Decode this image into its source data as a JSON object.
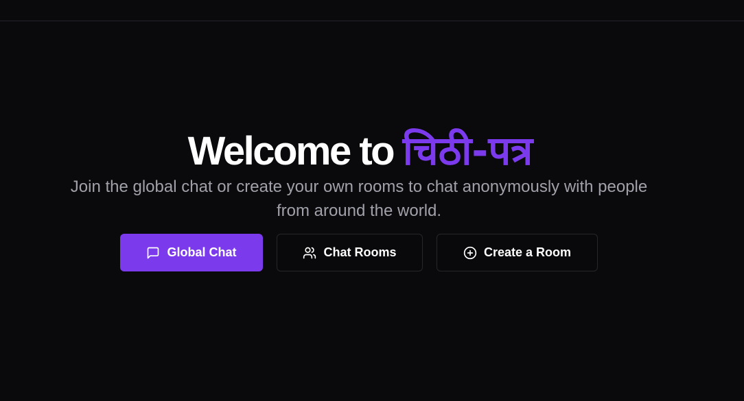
{
  "hero": {
    "title_prefix": "Welcome to ",
    "title_brand": "चिठी-पत्र",
    "subtitle": "Join the global chat or create your own rooms to chat anonymously with people from around the world."
  },
  "buttons": {
    "global_chat": {
      "label": "Global Chat",
      "icon": "message-square-icon"
    },
    "chat_rooms": {
      "label": "Chat Rooms",
      "icon": "users-icon"
    },
    "create_room": {
      "label": "Create a Room",
      "icon": "plus-circle-icon"
    }
  },
  "colors": {
    "background": "#0a0a0c",
    "accent": "#7c3aed",
    "text": "#ffffff",
    "muted_text": "#a1a1aa",
    "border": "#27272a"
  }
}
